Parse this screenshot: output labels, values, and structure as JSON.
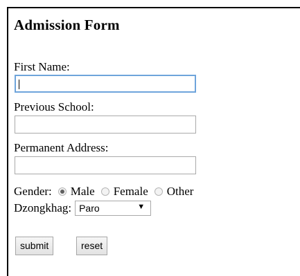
{
  "form": {
    "title": "Admission Form",
    "first_name_label": "First Name:",
    "first_name_value": "",
    "previous_school_label": "Previous School:",
    "previous_school_value": "",
    "permanent_address_label": "Permanent Address:",
    "permanent_address_value": "",
    "gender_label": "Gender:",
    "gender_options": [
      "Male",
      "Female",
      "Other"
    ],
    "gender_selected": "Male",
    "dzongkhag_label": "Dzongkhag:",
    "dzongkhag_selected": "Paro",
    "dzongkhag_arrow": "▼",
    "submit_label": "submit",
    "reset_label": "reset"
  },
  "colors": {
    "focus_border": "#6ea4db",
    "input_border": "#a9a9a9"
  },
  "icons": {
    "dropdown": "chevron-down-icon"
  }
}
